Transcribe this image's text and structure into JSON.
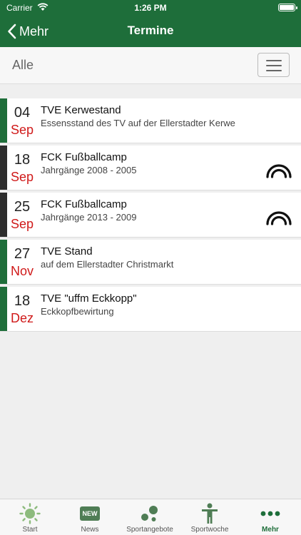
{
  "status_bar": {
    "carrier": "Carrier",
    "time": "1:26 PM"
  },
  "nav": {
    "back_label": "Mehr",
    "title": "Termine"
  },
  "filter": {
    "label": "Alle"
  },
  "events": [
    {
      "day": "04",
      "month": "Sep",
      "title": "TVE Kerwestand",
      "subtitle": "Essensstand des TV auf der Ellerstadter Kerwe",
      "bar_color": "#1e6e3a",
      "icon": ""
    },
    {
      "day": "18",
      "month": "Sep",
      "title": "FCK Fußballcamp",
      "subtitle": "Jahrgänge 2008 - 2005",
      "bar_color": "#2d2d2d",
      "icon": "arc-icon"
    },
    {
      "day": "25",
      "month": "Sep",
      "title": "FCK Fußballcamp",
      "subtitle": "Jahrgänge 2013 - 2009",
      "bar_color": "#2d2d2d",
      "icon": "arc-icon"
    },
    {
      "day": "27",
      "month": "Nov",
      "title": "TVE Stand",
      "subtitle": "auf dem Ellerstadter Christmarkt",
      "bar_color": "#1e6e3a",
      "icon": ""
    },
    {
      "day": "18",
      "month": "Dez",
      "title": "TVE \"uffm Eckkopp\"",
      "subtitle": "Eckkopfbewirtung",
      "bar_color": "#1e6e3a",
      "icon": ""
    }
  ],
  "tabs": [
    {
      "label": "Start",
      "icon": "sun-icon"
    },
    {
      "label": "News",
      "icon": "new-badge-icon",
      "badge_text": "NEW"
    },
    {
      "label": "Sportangebote",
      "icon": "balls-icon"
    },
    {
      "label": "Sportwoche",
      "icon": "person-icon"
    },
    {
      "label": "Mehr",
      "icon": "more-dots-icon",
      "active": true
    }
  ],
  "colors": {
    "brand_green": "#1e6e3a",
    "month_red": "#d01a1a",
    "event_dark": "#2d2d2d"
  }
}
